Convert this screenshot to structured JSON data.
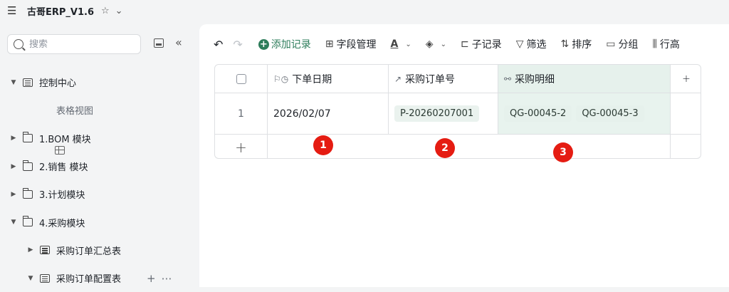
{
  "app": {
    "title": "古哥ERP_V1.6"
  },
  "search": {
    "placeholder": "搜索"
  },
  "tree": [
    {
      "label": "控制中心",
      "arrow": "▼",
      "icon": "doc",
      "indent": 0
    },
    {
      "label": "表格视图",
      "arrow": "",
      "icon": "grid",
      "indent": 1
    },
    {
      "label": "1.BOM 模块",
      "arrow": "▶",
      "icon": "folder",
      "indent": 0
    },
    {
      "label": "2.销售 模块",
      "arrow": "▶",
      "icon": "folder",
      "indent": 0
    },
    {
      "label": "3.计划模块",
      "arrow": "▶",
      "icon": "folder",
      "indent": 0
    },
    {
      "label": "4.采购模块",
      "arrow": "▼",
      "icon": "folder",
      "indent": 0
    },
    {
      "label": "采购订单汇总表",
      "arrow": "▶",
      "icon": "doc",
      "indent": 1
    },
    {
      "label": "采购订单配置表",
      "arrow": "▼",
      "icon": "doc",
      "indent": 1
    }
  ],
  "toolbar": {
    "add_record": "添加记录",
    "field_manage": "字段管理",
    "sub_record": "子记录",
    "filter": "筛选",
    "sort": "排序",
    "group": "分组",
    "row_height": "行高"
  },
  "table": {
    "headers": [
      "下单日期",
      "采购订单号",
      "采购明细"
    ],
    "rows": [
      {
        "index": "1",
        "date": "2026/02/07",
        "order_no": "P-20260207001",
        "details": [
          "QG-00045-2",
          "QG-00045-3"
        ]
      }
    ]
  },
  "badges": [
    "1",
    "2",
    "3"
  ],
  "colors": {
    "accent": "#2e7d5b",
    "badge": "#e51c12",
    "selected_col": "#e8f3ee"
  }
}
